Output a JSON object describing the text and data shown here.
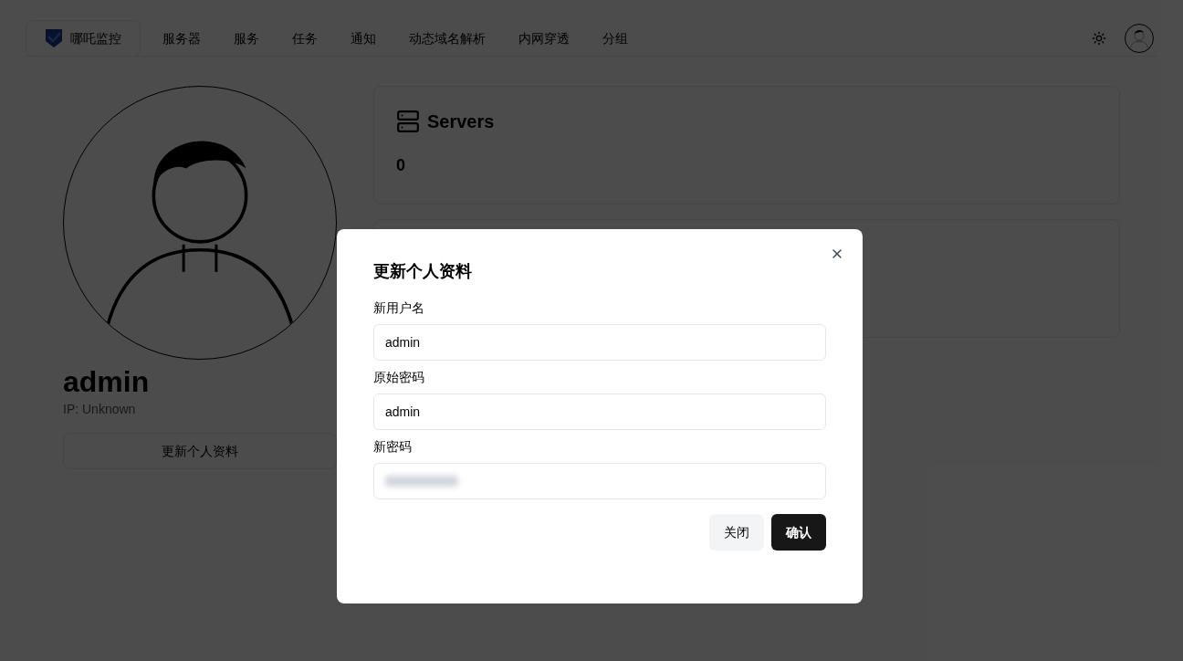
{
  "header": {
    "brand": "哪吒监控",
    "nav": [
      {
        "label": "服务器"
      },
      {
        "label": "服务"
      },
      {
        "label": "任务"
      },
      {
        "label": "通知"
      },
      {
        "label": "动态域名解析"
      },
      {
        "label": "内网穿透"
      },
      {
        "label": "分组"
      }
    ]
  },
  "profile": {
    "name": "admin",
    "ip": "IP: Unknown",
    "button": "更新个人资料"
  },
  "stats": [
    {
      "title": "Servers",
      "value": "0"
    }
  ],
  "dialog": {
    "title": "更新个人资料",
    "fields": [
      {
        "label": "新用户名",
        "value": "admin",
        "blurred": false
      },
      {
        "label": "原始密码",
        "value": "admin",
        "blurred": false
      },
      {
        "label": "新密码",
        "blurred": true
      }
    ],
    "buttons": [
      {
        "label": "关闭",
        "kind": "secondary"
      },
      {
        "label": "确认",
        "kind": "primary"
      }
    ]
  }
}
